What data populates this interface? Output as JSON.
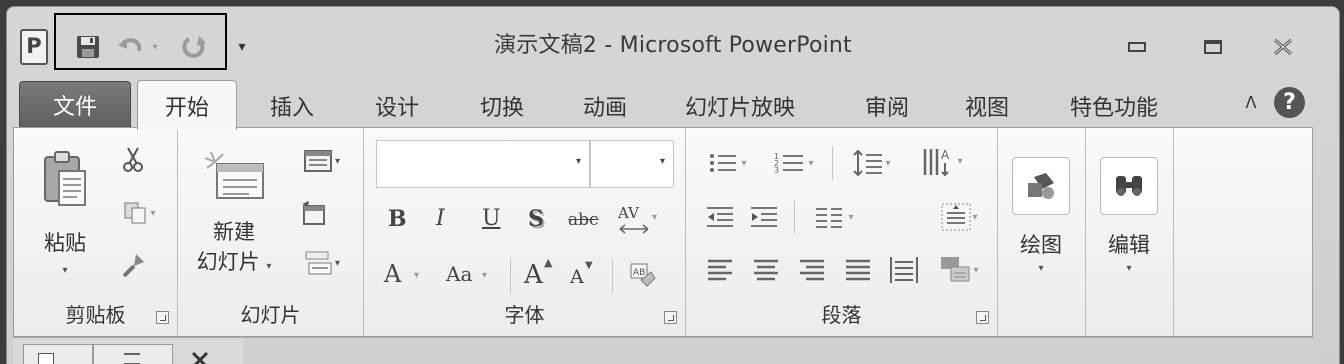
{
  "window": {
    "app_icon_letter": "P",
    "title": "演示文稿2  -  Microsoft PowerPoint"
  },
  "quick_access": {
    "save_icon": "save-icon",
    "undo_icon": "undo-icon",
    "redo_icon": "redo-icon",
    "customize_glyph": "▾"
  },
  "window_controls": {
    "minimize": "minimize-icon",
    "restore": "restore-icon",
    "close": "close-icon"
  },
  "tabs": [
    {
      "label": "文件"
    },
    {
      "label": "开始"
    },
    {
      "label": "插入"
    },
    {
      "label": "设计"
    },
    {
      "label": "切换"
    },
    {
      "label": "动画"
    },
    {
      "label": "幻灯片放映"
    },
    {
      "label": "审阅"
    },
    {
      "label": "视图"
    },
    {
      "label": "特色功能"
    }
  ],
  "tabbar_right": {
    "collapse_glyph": "ᐱ",
    "help_glyph": "?"
  },
  "ribbon": {
    "clipboard": {
      "label": "剪贴板",
      "paste_label": "粘贴",
      "paste_arrow": "▾"
    },
    "slides": {
      "label": "幻灯片",
      "new_slide_line1": "新建",
      "new_slide_line2": "幻灯片",
      "new_slide_arrow": "▾"
    },
    "font": {
      "label": "字体",
      "font_name_value": "",
      "font_size_value": "",
      "bold": "B",
      "italic": "I",
      "underline": "U",
      "shadow": "S",
      "strike": "abc",
      "spacing": "AV",
      "font_color": "A",
      "change_case": "Aa",
      "grow": "A",
      "shrink": "A"
    },
    "paragraph": {
      "label": "段落"
    },
    "drawing": {
      "label": "绘图",
      "arrow": "▾"
    },
    "editing": {
      "label": "编辑",
      "arrow": "▾"
    }
  },
  "colors": {
    "frame": "#cfcfcf",
    "file_tab": "#666666",
    "ribbon": "#f4f4f4",
    "highlight_box": "#000000"
  }
}
